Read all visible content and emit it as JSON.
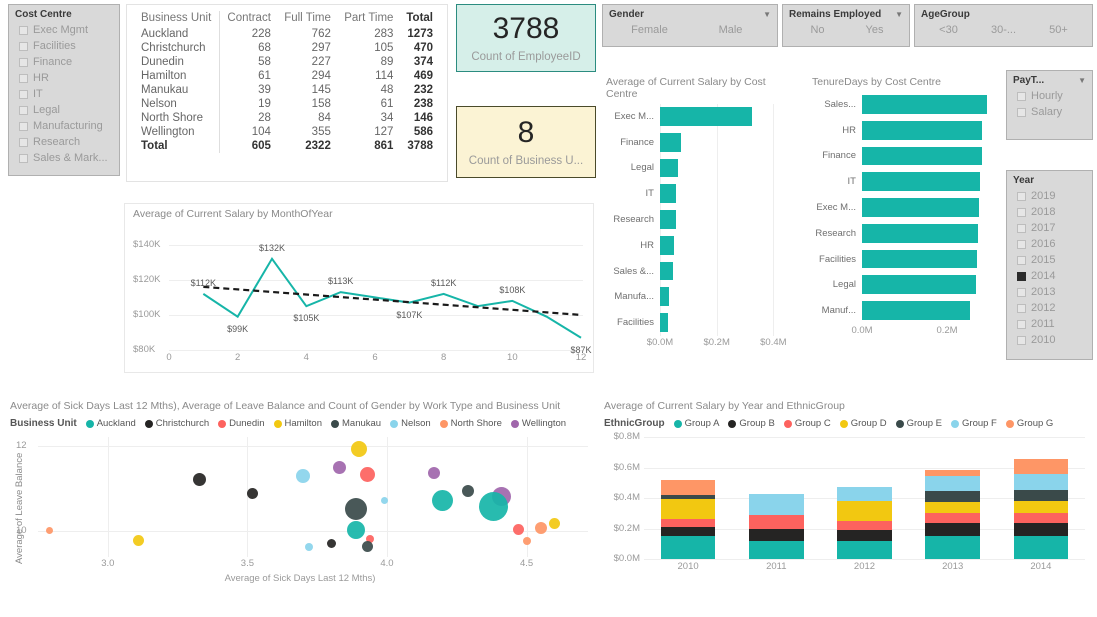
{
  "slicers": {
    "cost_centre": {
      "title": "Cost Centre",
      "items": [
        "Exec Mgmt",
        "Facilities",
        "Finance",
        "HR",
        "IT",
        "Legal",
        "Manufacturing",
        "Research",
        "Sales & Mark..."
      ]
    },
    "business_unit": {
      "title": "Business Unit",
      "items": [
        "Auckland",
        "Christchurch",
        "Dunedin",
        "Hamilton",
        "Manukau",
        "Nelson",
        "North Shore",
        "Wellington"
      ]
    },
    "gender": {
      "title": "Gender",
      "items": [
        "Female",
        "Male"
      ]
    },
    "remains_employed": {
      "title": "Remains Employed",
      "items": [
        "No",
        "Yes"
      ]
    },
    "age_group": {
      "title": "AgeGroup",
      "items": [
        "<30",
        "30-...",
        "50+"
      ]
    },
    "pay_type": {
      "title": "PayT...",
      "items": [
        "Hourly",
        "Salary"
      ]
    },
    "year": {
      "title": "Year",
      "items": [
        "2019",
        "2018",
        "2017",
        "2016",
        "2015",
        "2014",
        "2013",
        "2012",
        "2011",
        "2010"
      ],
      "selected": "2014"
    }
  },
  "bu_table": {
    "columns": [
      "Business Unit",
      "Contract",
      "Full Time",
      "Part Time",
      "Total"
    ],
    "rows": [
      [
        "Auckland",
        "228",
        "762",
        "283",
        "1273"
      ],
      [
        "Christchurch",
        "68",
        "297",
        "105",
        "470"
      ],
      [
        "Dunedin",
        "58",
        "227",
        "89",
        "374"
      ],
      [
        "Hamilton",
        "61",
        "294",
        "114",
        "469"
      ],
      [
        "Manukau",
        "39",
        "145",
        "48",
        "232"
      ],
      [
        "Nelson",
        "19",
        "158",
        "61",
        "238"
      ],
      [
        "North Shore",
        "28",
        "84",
        "34",
        "146"
      ],
      [
        "Wellington",
        "104",
        "355",
        "127",
        "586"
      ]
    ],
    "total_row": [
      "Total",
      "605",
      "2322",
      "861",
      "3788"
    ]
  },
  "kpis": [
    {
      "value": "3788",
      "caption": "Count of EmployeeID",
      "color": "#d6efe9"
    },
    {
      "value": "8",
      "caption": "Count of Business U...",
      "color": "#fbf3d4"
    }
  ],
  "chart_data": [
    {
      "type": "bar",
      "orientation": "horizontal",
      "title": "Average of Current Salary by Cost Centre",
      "categories": [
        "Exec M...",
        "Finance",
        "Legal",
        "IT",
        "Research",
        "HR",
        "Sales &...",
        "Manufa...",
        "Facilities"
      ],
      "values": [
        0.325,
        0.074,
        0.064,
        0.058,
        0.058,
        0.05,
        0.047,
        0.031,
        0.028
      ],
      "xlabel": "",
      "ylabel": "",
      "xticks": [
        "$0.0M",
        "$0.2M",
        "$0.4M"
      ],
      "xlim": [
        0,
        0.48
      ],
      "color": "#16b5a8",
      "grid": true
    },
    {
      "type": "bar",
      "orientation": "horizontal",
      "title": "TenureDays by Cost Centre",
      "categories": [
        "Sales...",
        "HR",
        "Finance",
        "IT",
        "Exec M...",
        "Research",
        "Facilities",
        "Legal",
        "Manuf..."
      ],
      "values": [
        0.293,
        0.283,
        0.283,
        0.278,
        0.276,
        0.273,
        0.271,
        0.268,
        0.255
      ],
      "xlabel": "",
      "ylabel": "",
      "xticks": [
        "0.0M",
        "0.2M"
      ],
      "xlim": [
        0,
        0.32
      ],
      "color": "#16b5a8",
      "grid": false
    },
    {
      "type": "line",
      "title": "Average of Current Salary by MonthOfYear",
      "x": [
        1,
        2,
        3,
        4,
        5,
        6,
        7,
        8,
        9,
        10,
        11,
        12
      ],
      "values": [
        112,
        99,
        132,
        105,
        113,
        110,
        107,
        112,
        105,
        108,
        99,
        87
      ],
      "point_labels": [
        "$112K",
        "$99K",
        "$132K",
        "$105K",
        "$113K",
        "",
        "$107K",
        "$112K",
        "",
        "$108K",
        "",
        "$87K"
      ],
      "trend": {
        "name": "Trend line",
        "start": 116,
        "end": 100,
        "style": "dashed",
        "color": "#1a1a1a"
      },
      "xlabel": "",
      "ylabel": "",
      "yticks": [
        "$80K",
        "$100K",
        "$120K",
        "$140K"
      ],
      "ylim": [
        80,
        145
      ],
      "xticks": [
        "0",
        "2",
        "4",
        "6",
        "8",
        "10",
        "12"
      ],
      "xlim": [
        0,
        12
      ],
      "color": "#16b5a8",
      "grid": true
    },
    {
      "type": "scatter",
      "title": "Average of Sick Days Last 12 Mths), Average of Leave Balance and Count of Gender by Work Type and Business Unit",
      "legend_title": "Business Unit",
      "legend_position": "top",
      "xlabel": "Average of Sick Days Last 12 Mths)",
      "ylabel": "Average of Leave Balance",
      "xticks": [
        "3.0",
        "3.5",
        "4.0",
        "4.5"
      ],
      "yticks": [
        "10",
        "12"
      ],
      "xlim": [
        2.75,
        4.72
      ],
      "ylim": [
        9.4,
        12.2
      ],
      "series": [
        {
          "name": "Auckland",
          "color": "#16b5a8"
        },
        {
          "name": "Christchurch",
          "color": "#252423"
        },
        {
          "name": "Dunedin",
          "color": "#fd625e"
        },
        {
          "name": "Hamilton",
          "color": "#f2c811"
        },
        {
          "name": "Manukau",
          "color": "#3a4a4a"
        },
        {
          "name": "Nelson",
          "color": "#8ad4eb"
        },
        {
          "name": "North Shore",
          "color": "#fe9666"
        },
        {
          "name": "Wellington",
          "color": "#a066ab"
        }
      ],
      "points": [
        {
          "s": "North Shore",
          "x": 2.79,
          "y": 10.03,
          "size": 7
        },
        {
          "s": "Hamilton",
          "x": 3.11,
          "y": 9.78,
          "size": 11
        },
        {
          "s": "Christchurch",
          "x": 3.33,
          "y": 11.22,
          "size": 13
        },
        {
          "s": "Christchurch",
          "x": 3.52,
          "y": 10.88,
          "size": 11
        },
        {
          "s": "Nelson",
          "x": 3.7,
          "y": 11.3,
          "size": 14
        },
        {
          "s": "Nelson",
          "x": 3.72,
          "y": 9.63,
          "size": 8
        },
        {
          "s": "Christchurch",
          "x": 3.8,
          "y": 9.72,
          "size": 9
        },
        {
          "s": "Wellington",
          "x": 3.83,
          "y": 11.5,
          "size": 13
        },
        {
          "s": "Hamilton",
          "x": 3.9,
          "y": 11.92,
          "size": 16
        },
        {
          "s": "Manukau",
          "x": 3.89,
          "y": 10.52,
          "size": 22
        },
        {
          "s": "Auckland",
          "x": 3.89,
          "y": 10.04,
          "size": 18
        },
        {
          "s": "Dunedin",
          "x": 3.93,
          "y": 11.32,
          "size": 15
        },
        {
          "s": "Dunedin",
          "x": 3.94,
          "y": 9.82,
          "size": 8
        },
        {
          "s": "Manukau",
          "x": 3.93,
          "y": 9.65,
          "size": 11
        },
        {
          "s": "Nelson",
          "x": 3.99,
          "y": 10.72,
          "size": 7
        },
        {
          "s": "Wellington",
          "x": 4.17,
          "y": 11.35,
          "size": 12
        },
        {
          "s": "Auckland",
          "x": 4.2,
          "y": 10.72,
          "size": 21
        },
        {
          "s": "Manukau",
          "x": 4.29,
          "y": 10.95,
          "size": 12
        },
        {
          "s": "Wellington",
          "x": 4.41,
          "y": 10.82,
          "size": 19
        },
        {
          "s": "Auckland",
          "x": 4.38,
          "y": 10.58,
          "size": 29
        },
        {
          "s": "Dunedin",
          "x": 4.47,
          "y": 10.05,
          "size": 11
        },
        {
          "s": "North Shore",
          "x": 4.5,
          "y": 9.78,
          "size": 8
        },
        {
          "s": "North Shore",
          "x": 4.55,
          "y": 10.07,
          "size": 12
        },
        {
          "s": "Hamilton",
          "x": 4.6,
          "y": 10.18,
          "size": 11
        }
      ]
    },
    {
      "type": "bar",
      "subtype": "stacked",
      "title": "Average of Current Salary by Year and EthnicGroup",
      "legend_title": "EthnicGroup",
      "categories": [
        "2010",
        "2011",
        "2012",
        "2013",
        "2014"
      ],
      "yticks": [
        "$0.0M",
        "$0.2M",
        "$0.4M",
        "$0.6M",
        "$0.8M"
      ],
      "ylim": [
        0,
        0.8
      ],
      "series": [
        {
          "name": "Group A",
          "color": "#16b5a8",
          "values": [
            0.15,
            0.12,
            0.118,
            0.152,
            0.15
          ]
        },
        {
          "name": "Group B",
          "color": "#252423",
          "values": [
            0.06,
            0.075,
            0.072,
            0.085,
            0.085
          ]
        },
        {
          "name": "Group C",
          "color": "#fd625e",
          "values": [
            0.055,
            0.092,
            0.06,
            0.067,
            0.068
          ]
        },
        {
          "name": "Group D",
          "color": "#f2c811",
          "values": [
            0.128,
            0.0,
            0.132,
            0.07,
            0.075
          ]
        },
        {
          "name": "Group E",
          "color": "#3a4a4a",
          "values": [
            0.03,
            0.0,
            0.0,
            0.075,
            0.075
          ]
        },
        {
          "name": "Group F",
          "color": "#8ad4eb",
          "values": [
            0.0,
            0.142,
            0.093,
            0.093,
            0.105
          ]
        },
        {
          "name": "Group G",
          "color": "#fe9666",
          "values": [
            0.095,
            0.0,
            0.0,
            0.04,
            0.098
          ]
        }
      ],
      "totals": [
        0.618,
        0.429,
        0.475,
        0.682,
        0.716
      ]
    }
  ]
}
